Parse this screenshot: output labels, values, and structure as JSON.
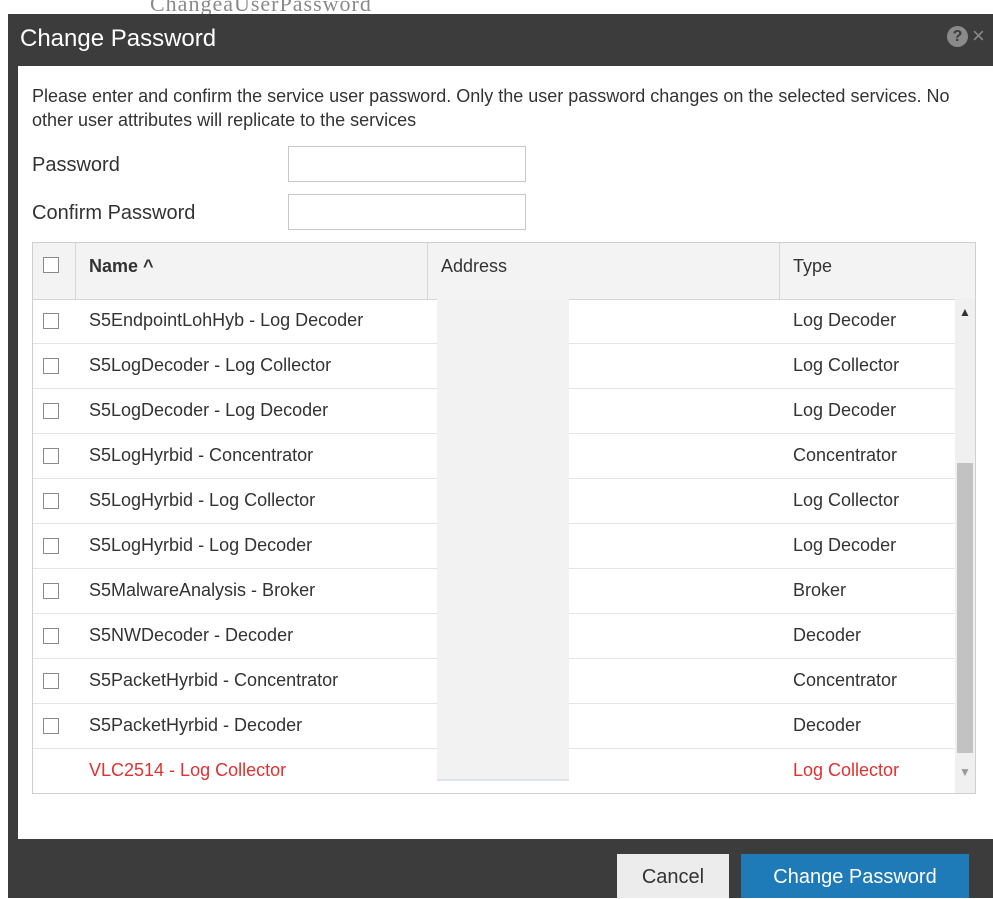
{
  "background_text": "ChangeaUserPassword",
  "dialog": {
    "title": "Change Password",
    "help_icon": "?",
    "close_icon": "×",
    "intro": "Please enter and confirm the service user password. Only the user password changes on the selected services. No other user attributes will replicate to the services"
  },
  "form": {
    "password_label": "Password",
    "password_value": "",
    "confirm_label": "Confirm Password",
    "confirm_value": ""
  },
  "grid": {
    "columns": {
      "name": "Name ^",
      "address": "Address",
      "type": "Type"
    },
    "rows": [
      {
        "name": "S5EndpointLohHyb - Log Decoder",
        "type": "Log Decoder"
      },
      {
        "name": "S5LogDecoder - Log Collector",
        "type": "Log Collector"
      },
      {
        "name": "S5LogDecoder - Log Decoder",
        "type": "Log Decoder"
      },
      {
        "name": "S5LogHyrbid - Concentrator",
        "type": "Concentrator"
      },
      {
        "name": "S5LogHyrbid - Log Collector",
        "type": "Log Collector"
      },
      {
        "name": "S5LogHyrbid - Log Decoder",
        "type": "Log Decoder"
      },
      {
        "name": "S5MalwareAnalysis - Broker",
        "type": "Broker"
      },
      {
        "name": "S5NWDecoder - Decoder",
        "type": "Decoder"
      },
      {
        "name": "S5PacketHyrbid - Concentrator",
        "type": "Concentrator"
      },
      {
        "name": "S5PacketHyrbid - Decoder",
        "type": "Decoder"
      },
      {
        "name": "VLC2514 - Log Collector",
        "type": "Log Collector"
      }
    ],
    "error_color": "#e03131"
  },
  "buttons": {
    "cancel": "Cancel",
    "change_password": "Change Password"
  },
  "colors": {
    "header": "#3c3c3c",
    "primary": "#1f7ab8",
    "error": "#e03131"
  }
}
